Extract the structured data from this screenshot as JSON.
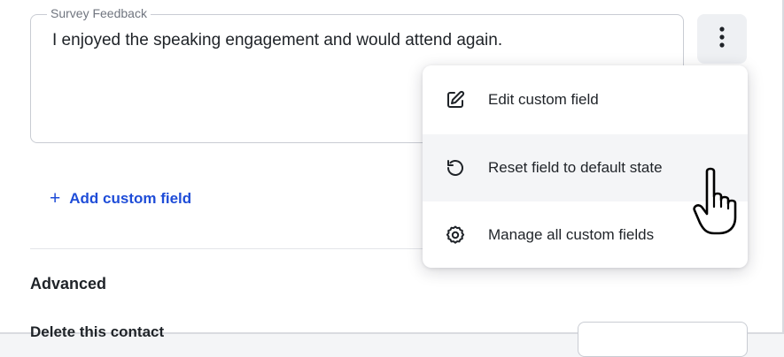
{
  "survey_field": {
    "legend": "Survey Feedback",
    "value": "I enjoyed the speaking engagement and would attend again."
  },
  "kebab": {
    "icon": "more-vertical-icon"
  },
  "add_custom_field": {
    "icon": "plus-icon",
    "symbol": "+",
    "label": "Add custom field"
  },
  "advanced_section": {
    "heading": "Advanced",
    "delete_label": "Delete this contact"
  },
  "menu": {
    "items": [
      {
        "label": "Edit custom field",
        "icon": "edit-icon"
      },
      {
        "label": "Reset field to default state",
        "icon": "reset-icon"
      },
      {
        "label": "Manage all custom fields",
        "icon": "gear-icon"
      }
    ]
  },
  "colors": {
    "accent": "#1f4dd8",
    "text": "#1f2328",
    "muted": "#70757f",
    "border": "#c9ccd3",
    "hover_bg": "#f4f5f7"
  }
}
